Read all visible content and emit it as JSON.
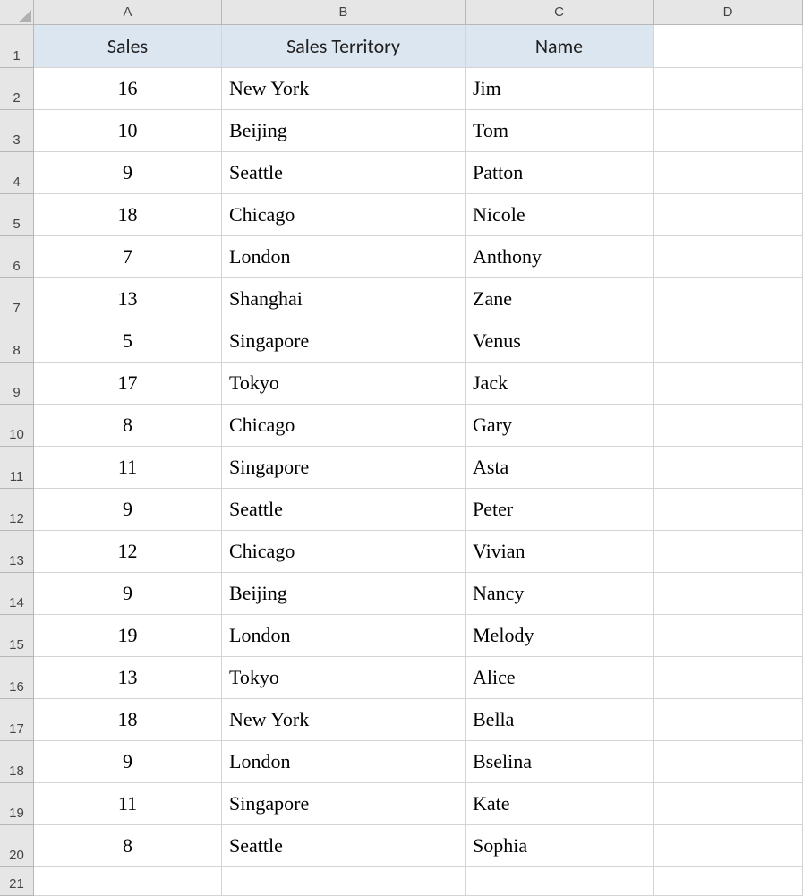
{
  "columns": [
    "A",
    "B",
    "C",
    "D"
  ],
  "rowCount": 21,
  "header": {
    "sales": "Sales",
    "territory": "Sales Territory",
    "name": "Name"
  },
  "rows": [
    {
      "sales": "16",
      "territory": "New York",
      "name": "Jim"
    },
    {
      "sales": "10",
      "territory": "Beijing",
      "name": "Tom"
    },
    {
      "sales": "9",
      "territory": "Seattle",
      "name": "Patton"
    },
    {
      "sales": "18",
      "territory": "Chicago",
      "name": "Nicole"
    },
    {
      "sales": "7",
      "territory": "London",
      "name": "Anthony"
    },
    {
      "sales": "13",
      "territory": "Shanghai",
      "name": "Zane"
    },
    {
      "sales": "5",
      "territory": "Singapore",
      "name": "Venus"
    },
    {
      "sales": "17",
      "territory": "Tokyo",
      "name": "Jack"
    },
    {
      "sales": "8",
      "territory": "Chicago",
      "name": "Gary"
    },
    {
      "sales": "11",
      "territory": "Singapore",
      "name": "Asta"
    },
    {
      "sales": "9",
      "territory": "Seattle",
      "name": "Peter"
    },
    {
      "sales": "12",
      "territory": "Chicago",
      "name": "Vivian"
    },
    {
      "sales": "9",
      "territory": "Beijing",
      "name": "Nancy"
    },
    {
      "sales": "19",
      "territory": "London",
      "name": "Melody"
    },
    {
      "sales": "13",
      "territory": "Tokyo",
      "name": "Alice"
    },
    {
      "sales": "18",
      "territory": "New York",
      "name": "Bella"
    },
    {
      "sales": "9",
      "territory": "London",
      "name": "Bselina"
    },
    {
      "sales": "11",
      "territory": "Singapore",
      "name": "Kate"
    },
    {
      "sales": "8",
      "territory": "Seattle",
      "name": "Sophia"
    }
  ]
}
